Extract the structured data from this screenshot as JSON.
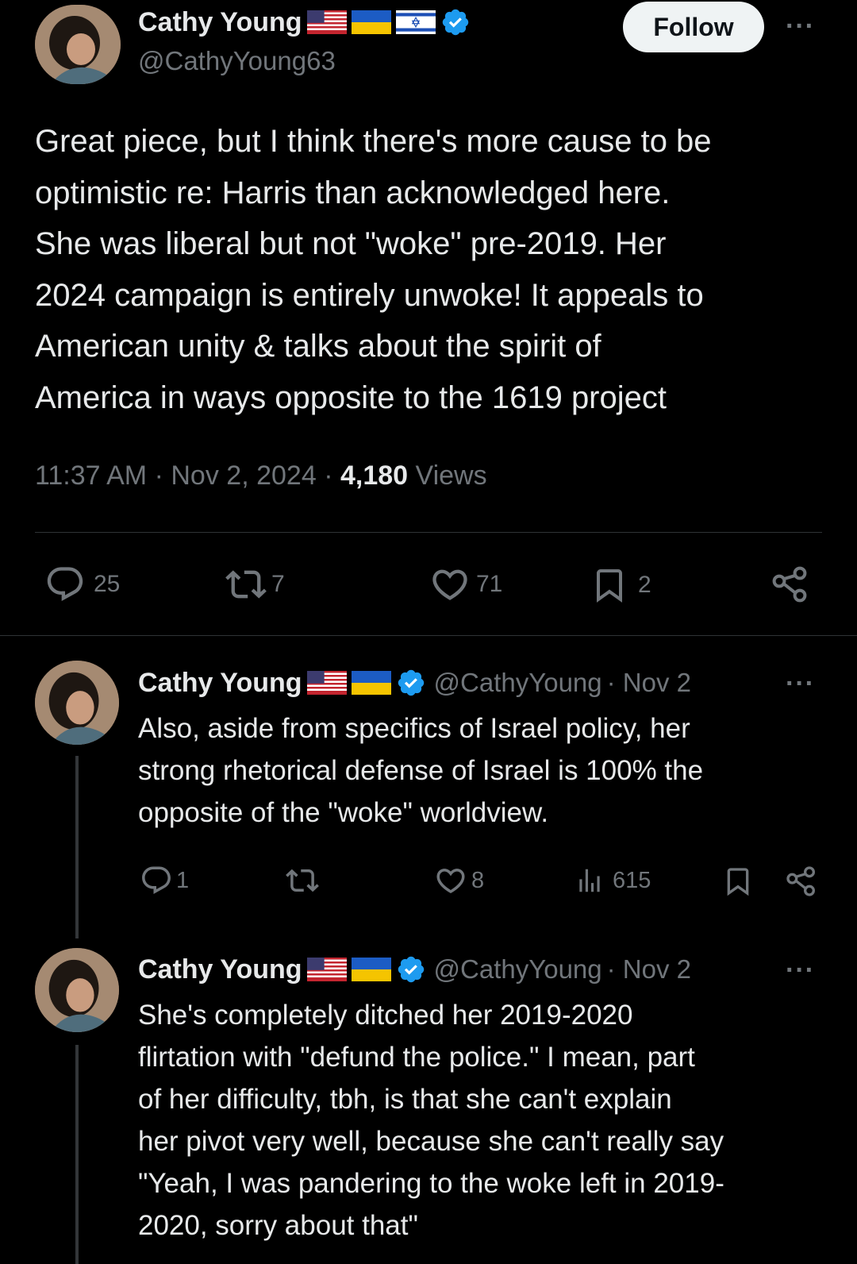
{
  "main_tweet": {
    "author_name": "Cathy Young",
    "author_handle": "@CathyYoung63",
    "follow_label": "Follow",
    "more_label": "···",
    "text_lines": [
      "Great piece, but I think there's more cause to be",
      "optimistic re: Harris than acknowledged here.",
      "She was liberal but not \"woke\" pre-2019. Her",
      "2024 campaign is entirely unwoke! It appeals to",
      "American unity & talks about the spirit of",
      "America in ways opposite to the 1619 project"
    ],
    "time": "11:37 AM",
    "date": "Nov 2, 2024",
    "views_count": "4,180",
    "views_label": "Views",
    "sep": "·",
    "actions": {
      "replies": "25",
      "reposts": "7",
      "likes": "71",
      "bookmarks": "2"
    }
  },
  "replies": [
    {
      "author_name": "Cathy Young",
      "author_handle": "@CathyYoung",
      "date": "· Nov 2",
      "more_label": "···",
      "text_lines": [
        "Also, aside from specifics of Israel policy, her",
        "strong rhetorical defense of Israel is 100% the",
        "opposite of the \"woke\" worldview."
      ],
      "actions": {
        "replies": "1",
        "reposts": "",
        "likes": "8",
        "views": "615"
      }
    },
    {
      "author_name": "Cathy Young",
      "author_handle": "@CathyYoung",
      "date": "· Nov 2",
      "more_label": "···",
      "text_lines": [
        "She's completely ditched her 2019-2020",
        "flirtation with \"defund the police.\" I mean, part",
        "of her difficulty, tbh, is that she can't explain",
        "her pivot very well, because she can't really say",
        "\"Yeah, I was pandering to the woke left in 2019-",
        "2020, sorry about that\""
      ]
    }
  ],
  "icons": {
    "verified": "verified-badge-icon",
    "flags": [
      "us-flag-icon",
      "ukraine-flag-icon",
      "israel-flag-icon"
    ]
  },
  "colors": {
    "background": "#000000",
    "text": "#e7e9ea",
    "secondary": "#71767b",
    "verified": "#1d9bf0"
  }
}
